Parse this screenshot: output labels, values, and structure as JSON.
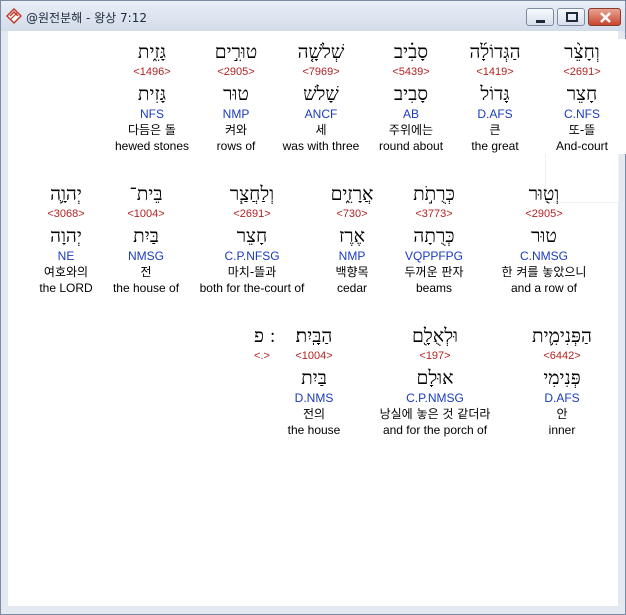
{
  "window": {
    "title": "@원전분해 - 왕상 7:12",
    "controls": {
      "minimize": "minimize",
      "maximize": "maximize",
      "close": "close"
    }
  },
  "rows": [
    {
      "words": [
        {
          "heb": "גָּזִ֑ית",
          "strong": "<1496>",
          "lemma": "גָּזִית",
          "morph": "NFS",
          "kor": "다듬은 돌",
          "eng": "hewed stones"
        },
        {
          "heb": "טוּרִ֣ים",
          "strong": "<2905>",
          "lemma": "טוּר",
          "morph": "NMP",
          "kor": "켜와",
          "eng": "rows of"
        },
        {
          "heb": "שְׁלֹשָׁ֤ה",
          "strong": "<7969>",
          "lemma": "שָׁלֹשׁ",
          "morph": "ANCF",
          "kor": "세",
          "eng": "was with three"
        },
        {
          "heb": "סָבִ֗יב",
          "strong": "<5439>",
          "lemma": "סָבִיב",
          "morph": "AB",
          "kor": "주위에는",
          "eng": "round about"
        },
        {
          "heb": "הַגְּדוֹלָ֜ה",
          "strong": "<1419>",
          "lemma": "גָּדוֹל",
          "morph": "D.AFS",
          "kor": "큰",
          "eng": "the great"
        },
        {
          "heb": "וְחָצֵ֨ר",
          "strong": "<2691>",
          "lemma": "חָצֵר",
          "morph": "C.NFS",
          "kor": "또-뜰",
          "eng": "And-court"
        }
      ]
    },
    {
      "words": [
        {
          "heb": "יְהוָ֛ה",
          "strong": "<3068>",
          "lemma": "יְהוָה",
          "morph": "NE",
          "kor": "여호와의",
          "eng": "the LORD"
        },
        {
          "heb": "בֵּית־",
          "strong": "<1004>",
          "lemma": "בַּיִת",
          "morph": "NMSG",
          "kor": "전",
          "eng": "the house of"
        },
        {
          "heb": "וְלַחֲצַ֧ר",
          "strong": "<2691>",
          "lemma": "חָצֵר",
          "morph": "C.P.NFSG",
          "kor": "마치-뜰과",
          "eng": "both for the-court of"
        },
        {
          "heb": "אֲרָזִ֑ים",
          "strong": "<730>",
          "lemma": "אֶרֶז",
          "morph": "NMP",
          "kor": "백향목",
          "eng": "cedar"
        },
        {
          "heb": "כְּרֻתֹ֣ת",
          "strong": "<3773>",
          "lemma": "כְּרֻתָה",
          "morph": "VQPPFPG",
          "kor": "두꺼운 판자",
          "eng": "beams"
        },
        {
          "heb": "וְט֖וּר",
          "strong": "<2905>",
          "lemma": "טוּר",
          "morph": "C.NMSG",
          "kor": "한 켜를 놓았으니",
          "eng": "and a row of"
        }
      ]
    },
    {
      "words": [
        {
          "heb": "׃ פ",
          "strong": "<.>",
          "lemma": "",
          "morph": "",
          "kor": "",
          "eng": ""
        },
        {
          "heb": "הַבָּֽיִת׃",
          "strong": "<1004>",
          "lemma": "בַּיִת",
          "morph": "D.NMS",
          "kor": "전의",
          "eng": "the house"
        },
        {
          "heb": "וּלְאֻלָ֖ם",
          "strong": "<197>",
          "lemma": "אוּלָם",
          "morph": "C.P.NMSG",
          "kor": "낭실에 놓은 것 같더라",
          "eng": "and for the porch of"
        },
        {
          "heb": "הַפְּנִימִ֛ית",
          "strong": "<6442>",
          "lemma": "פְּנִימִי",
          "morph": "D.AFS",
          "kor": "안",
          "eng": "inner"
        }
      ]
    }
  ]
}
